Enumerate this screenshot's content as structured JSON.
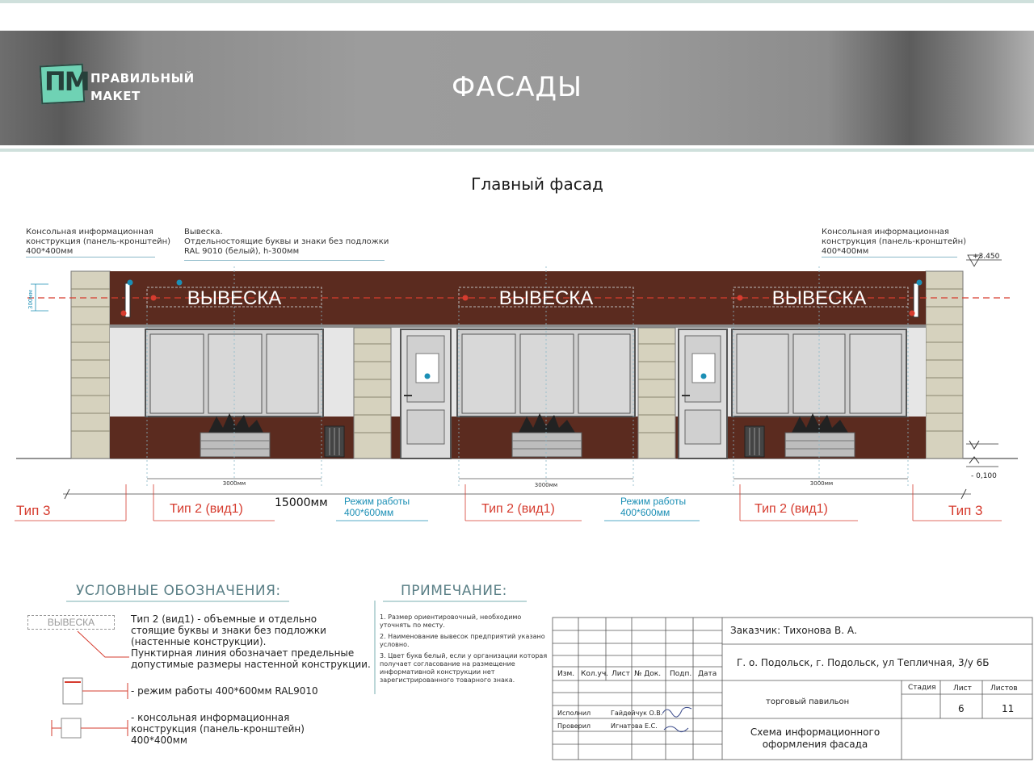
{
  "header": {
    "logo_letters": "ПМ",
    "logo_line1": "ПРАВИЛЬНЫЙ",
    "logo_line2": "МАКЕТ",
    "title": "ФАСАДЫ"
  },
  "section_title": "Главный фасад",
  "annotations": {
    "left_console": [
      "Консольная информационная",
      "конструкция (панель-кронштейн)",
      "400*400мм"
    ],
    "sign": [
      "Вывеска.",
      "Отдельностоящие буквы и знаки без подложки",
      "RAL 9010 (белый), h-300мм"
    ],
    "right_console": [
      "Консольная информационная",
      "конструкция (панель-кронштейн)",
      "400*400мм"
    ]
  },
  "facade": {
    "sign_texts": [
      "ВЫВЕСКА",
      "ВЫВЕСКА",
      "ВЫВЕСКА"
    ],
    "elev_top": "+3.450",
    "elev_bottom": "- 0,100",
    "sign_height": "300мм",
    "dim_3000": [
      "3000мм",
      "3000мм",
      "3000мм"
    ],
    "dim_total": "15000мм"
  },
  "labels": {
    "type3_left": "Тип 3",
    "type3_right": "Тип 3",
    "type2": [
      "Тип 2 (вид1)",
      "Тип 2 (вид1)",
      "Тип 2 (вид1)"
    ],
    "hours": [
      [
        "Режим работы",
        "400*600мм"
      ],
      [
        "Режим работы",
        "400*600мм"
      ]
    ]
  },
  "legend": {
    "title": "УСЛОВНЫЕ ОБОЗНАЧЕНИЯ:",
    "sample_sign": "ВЫВЕСКА",
    "item1": [
      "Тип 2 (вид1) - объемные и отдельно",
      "стоящие буквы и знаки без подложки",
      "(настенные конструкции).",
      "Пунктирная линия обозначает предельные",
      "допустимые размеры настенной конструкции."
    ],
    "item2": "- режим работы 400*600мм RAL9010",
    "item3": [
      "- консольная информационная",
      "конструкция (панель-кронштейн)",
      "400*400мм"
    ]
  },
  "notes": {
    "title": "ПРИМЕЧАНИЕ:",
    "items": [
      "1. Размер ориентировочный, необходимо уточнять по месту.",
      "2. Наименование вывесок предприятий указано условно.",
      "3. Цвет букв белый, если у организации которая получает согласование на размещение информативной конструкции нет зарегистрированного товарного знака."
    ]
  },
  "stamp": {
    "customer": "Заказчик: Тихонова В. А.",
    "address": "Г. о. Подольск, г. Подольск, ул Тепличная, 3/у 6Б",
    "headers": [
      "Изм.",
      "Кол.уч.",
      "Лист",
      "№ Док.",
      "Подп.",
      "Дата"
    ],
    "object": "торговый павильон",
    "stage_label": "Стадия",
    "sheet_label": "Лист",
    "sheets_label": "Листов",
    "sheet": "6",
    "sheets": "11",
    "performer_role": "Исполнил",
    "performer": "Гайдейчук О.В.",
    "checker_role": "Проверил",
    "checker": "Игнатова Е.С.",
    "drawing": [
      "Схема информационного",
      "оформления фасада"
    ]
  },
  "colors": {
    "frame": "#cfe0dc",
    "brown": "#5b2b1f",
    "red": "#d63c2f",
    "blue": "#1b8fb5",
    "accent": "#6fd2b4"
  }
}
